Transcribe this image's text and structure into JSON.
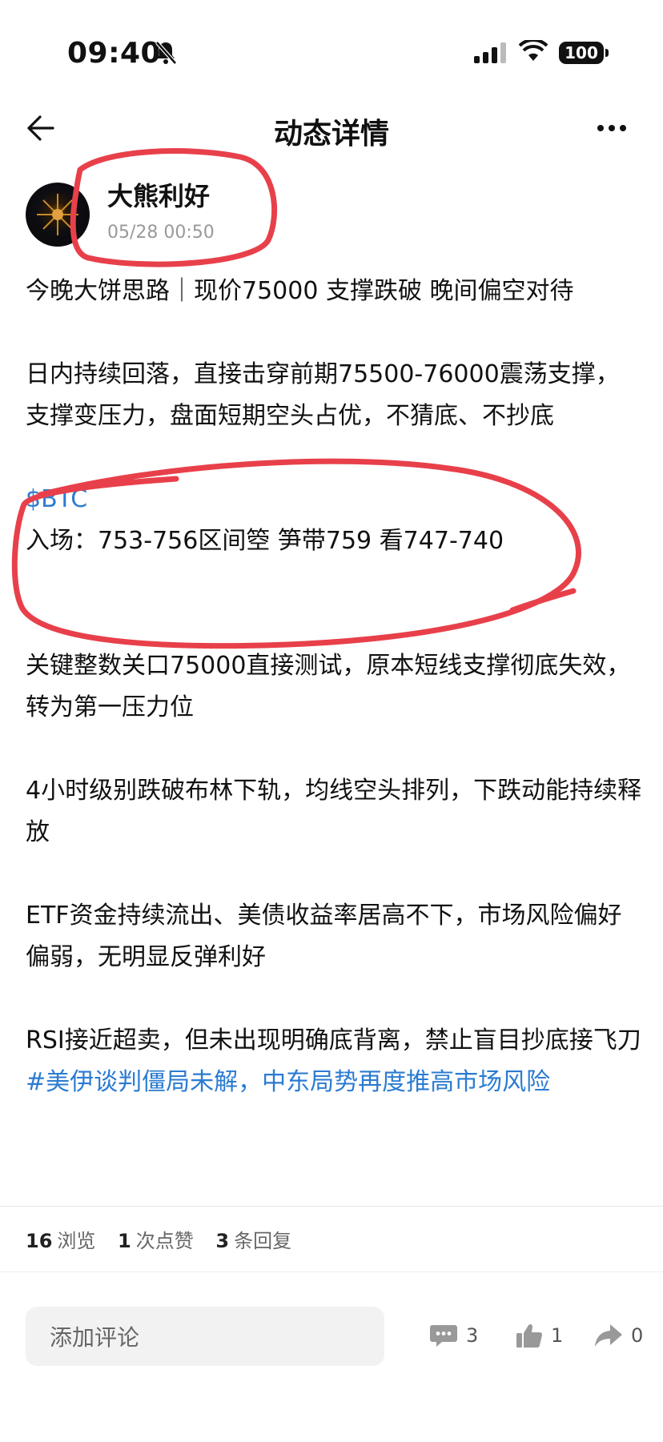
{
  "status_bar": {
    "time": "09:40",
    "battery": "100"
  },
  "nav": {
    "title": "动态详情"
  },
  "post": {
    "author": "大熊利好",
    "date": "05/28 00:50",
    "paragraphs": {
      "p1": "今晚大饼思路｜现价75000 支撑跌破 晚间偏空对待",
      "p2": "日内持续回落，直接击穿前期75500-76000震荡支撑，支撑变压力，盘面短期空头占优，不猜底、不抄底",
      "btc_tag": "$BTC",
      "entry": "入场：753-756区间箜 笋带759  看747-740",
      "p4": "关键整数关口75000直接测试，原本短线支撑彻底失效，转为第一压力位",
      "p5": "4小时级别跌破布林下轨，均线空头排列，下跌动能持续释放",
      "p6": "ETF资金持续流出、美债收益率居高不下，市场风险偏好偏弱，无明显反弹利好",
      "p7": "RSI接近超卖，但未出现明确底背离，禁止盲目抄底接飞刀",
      "hashtag": "#美伊谈判僵局未解，中东局势再度推高市场风险"
    }
  },
  "stats": {
    "views_count": "16",
    "views_label": "浏览",
    "likes_count": "1",
    "likes_label": "次点赞",
    "replies_count": "3",
    "replies_label": "条回复"
  },
  "bottom_bar": {
    "comment_placeholder": "添加评论",
    "comment_count": "3",
    "like_count": "1",
    "share_count": "0"
  },
  "colors": {
    "link": "#2b7bd1",
    "annotation": "#e8404a"
  }
}
